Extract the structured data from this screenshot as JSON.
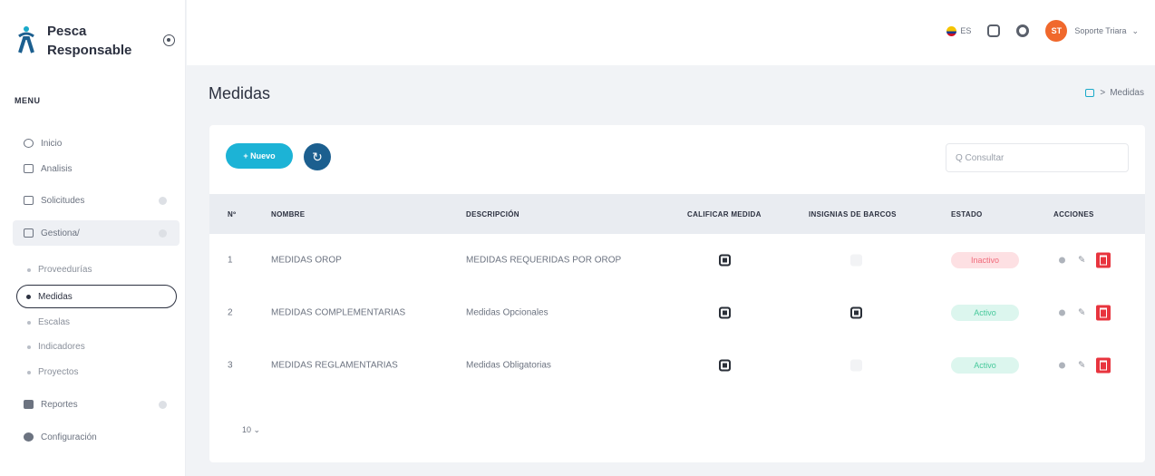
{
  "app": {
    "name_line1": "Pesca",
    "name_line2": "Responsable"
  },
  "sidebar": {
    "menu_title": "MENU",
    "items": [
      {
        "label": "Inicio"
      },
      {
        "label": "Analisis"
      },
      {
        "label": "Solicitudes"
      },
      {
        "label": "Gestiona/"
      },
      {
        "label": "Reportes"
      },
      {
        "label": "Configuración"
      }
    ],
    "sub_items": [
      {
        "label": "Proveedurías"
      },
      {
        "label": "Medidas"
      },
      {
        "label": "Escalas"
      },
      {
        "label": "Indicadores"
      },
      {
        "label": "Proyectos"
      }
    ]
  },
  "topbar": {
    "lang": "ES",
    "avatar_initials": "ST",
    "user_name": "Soporte Triara",
    "user_caret": "⌄"
  },
  "page": {
    "title": "Medidas",
    "breadcrumb_sep": ">",
    "breadcrumb_current": "Medidas"
  },
  "toolbar": {
    "new_label": "+ Nuevo",
    "refresh_icon": "↻",
    "search_placeholder": "Q Consultar"
  },
  "table": {
    "headers": [
      "Nº",
      "NOMBRE",
      "DESCRIPCIÓN",
      "CALIFICAR MEDIDA",
      "INSIGNIAS DE BARCOS",
      "ESTADO",
      "ACCIONES"
    ],
    "rows": [
      {
        "num": "1",
        "nombre": "MEDIDAS OROP",
        "descripcion": "MEDIDAS REQUERIDAS POR OROP",
        "calificar": true,
        "insignias": false,
        "estado": "Inactivo",
        "estado_key": "inactivo"
      },
      {
        "num": "2",
        "nombre": "MEDIDAS COMPLEMENTARIAS",
        "descripcion": "Medidas Opcionales",
        "calificar": true,
        "insignias": true,
        "estado": "Activo",
        "estado_key": "activo"
      },
      {
        "num": "3",
        "nombre": "MEDIDAS REGLAMENTARIAS",
        "descripcion": "Medidas Obligatorias",
        "calificar": true,
        "insignias": false,
        "estado": "Activo",
        "estado_key": "activo"
      }
    ],
    "page_size": "10 ⌄"
  },
  "colors": {
    "accent": "#1cb3d6",
    "refresh": "#1c5f8f",
    "danger": "#e8343e",
    "avatar": "#f0682c"
  }
}
